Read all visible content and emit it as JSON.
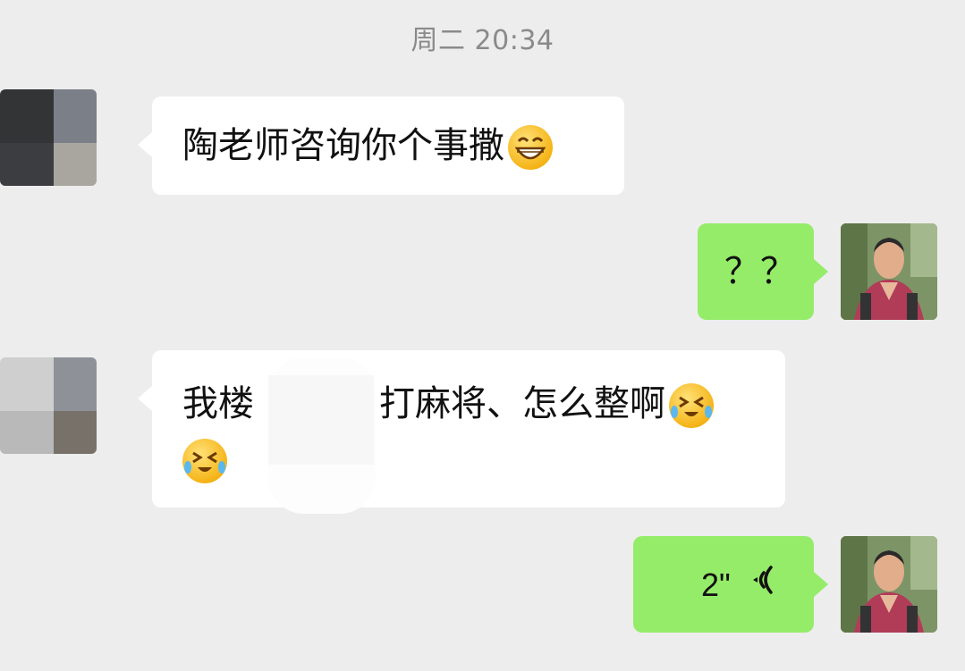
{
  "chat": {
    "timestamp": "周二 20:34",
    "messages": [
      {
        "side": "in",
        "text": "陶老师咨询你个事撒",
        "emoji": "grin-icon"
      },
      {
        "side": "out",
        "text": "？？"
      },
      {
        "side": "in",
        "text_a": "我楼",
        "text_b": "打麻将、怎么整啊",
        "emoji": "laughing-tears-icon"
      },
      {
        "side": "out",
        "voice_duration": "2\"",
        "icon": "voice-wave-icon"
      }
    ]
  },
  "colors": {
    "background": "#ededed",
    "incoming_bubble": "#ffffff",
    "outgoing_bubble": "#95ec69"
  }
}
